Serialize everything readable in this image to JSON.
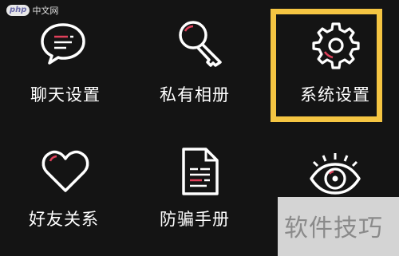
{
  "menu": {
    "items": [
      {
        "label": "聊天设置",
        "icon": "chat-bubble-icon"
      },
      {
        "label": "私有相册",
        "icon": "key-icon"
      },
      {
        "label": "系统设置",
        "icon": "gear-icon",
        "highlighted": true
      },
      {
        "label": "好友关系",
        "icon": "heart-icon"
      },
      {
        "label": "防骗手册",
        "icon": "document-icon"
      },
      {
        "label": "",
        "icon": "eye-icon"
      }
    ]
  },
  "watermark": {
    "logo_badge": "php",
    "logo_site": "中文网",
    "corner_text": "软件技巧"
  },
  "colors": {
    "background": "#141414",
    "icon_stroke": "#ffffff",
    "icon_accent": "#e0405a",
    "highlight_border": "#f5c542"
  }
}
